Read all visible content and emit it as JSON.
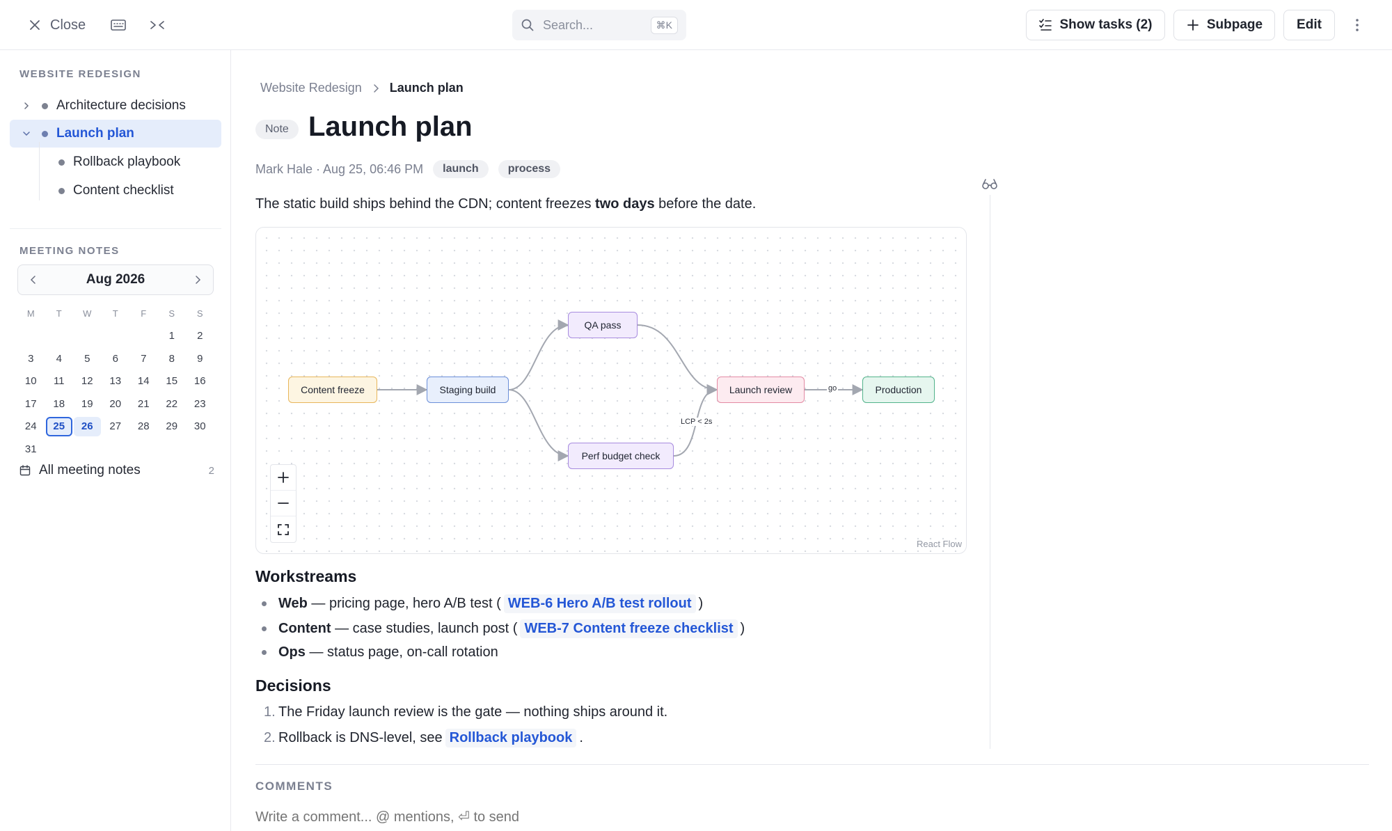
{
  "topbar": {
    "close_label": "Close",
    "search_placeholder": "Search...",
    "search_shortcut": "⌘K",
    "show_tasks_label": "Show tasks (2)",
    "subpage_label": "Subpage",
    "edit_label": "Edit"
  },
  "sidebar": {
    "section_title": "WEBSITE REDESIGN",
    "tree": [
      {
        "label": "Architecture decisions",
        "expanded": false,
        "active": false
      },
      {
        "label": "Launch plan",
        "expanded": true,
        "active": true
      },
      {
        "label": "Rollback playbook",
        "child": true
      },
      {
        "label": "Content checklist",
        "child": true
      }
    ],
    "meeting_title": "MEETING NOTES",
    "calendar": {
      "month": "Aug 2026",
      "weekdays": [
        "M",
        "T",
        "W",
        "T",
        "F",
        "S",
        "S"
      ],
      "days": [
        "",
        "",
        "",
        "",
        "",
        "1",
        "2",
        "3",
        "4",
        "5",
        "6",
        "7",
        "8",
        "9",
        "10",
        "11",
        "12",
        "13",
        "14",
        "15",
        "16",
        "17",
        "18",
        "19",
        "20",
        "21",
        "22",
        "23",
        "24",
        "25",
        "26",
        "27",
        "28",
        "29",
        "30",
        "31"
      ],
      "selected": "25",
      "highlighted": "26"
    },
    "all_notes_label": "All meeting notes",
    "all_notes_count": "2"
  },
  "page": {
    "breadcrumb_parent": "Website Redesign",
    "breadcrumb_current": "Launch plan",
    "badge": "Note",
    "title": "Launch plan",
    "meta": "Mark Hale · Aug 25, 06:46 PM",
    "tags": [
      "launch",
      "process"
    ],
    "intro_before": "The static build ships behind the CDN; content freezes ",
    "intro_bold": "two days",
    "intro_after": " before the date."
  },
  "flow": {
    "nodes": {
      "freeze": "Content freeze",
      "staging": "Staging build",
      "qa": "QA pass",
      "perf": "Perf budget check",
      "review": "Launch review",
      "prod": "Production"
    },
    "edge_labels": {
      "go": "go",
      "lcp": "LCP < 2s"
    },
    "attribution": "React Flow"
  },
  "workstreams": {
    "heading": "Workstreams",
    "items": [
      {
        "bold": "Web",
        "text": " — pricing page, hero A/B test (",
        "link": "WEB-6 Hero A/B test rollout",
        "after": ")"
      },
      {
        "bold": "Content",
        "text": " — case studies, launch post (",
        "link": "WEB-7 Content freeze checklist",
        "after": ")"
      },
      {
        "bold": "Ops",
        "text": " — status page, on-call rotation"
      }
    ]
  },
  "decisions": {
    "heading": "Decisions",
    "items": [
      {
        "num": "1.",
        "text": "The Friday launch review is the gate — nothing ships around it."
      },
      {
        "num": "2.",
        "text": "Rollback is DNS-level, see",
        "link": "Rollback playbook",
        "after": "."
      }
    ]
  },
  "comments": {
    "title": "COMMENTS",
    "placeholder": "Write a comment... @ mentions, ⏎ to send"
  }
}
